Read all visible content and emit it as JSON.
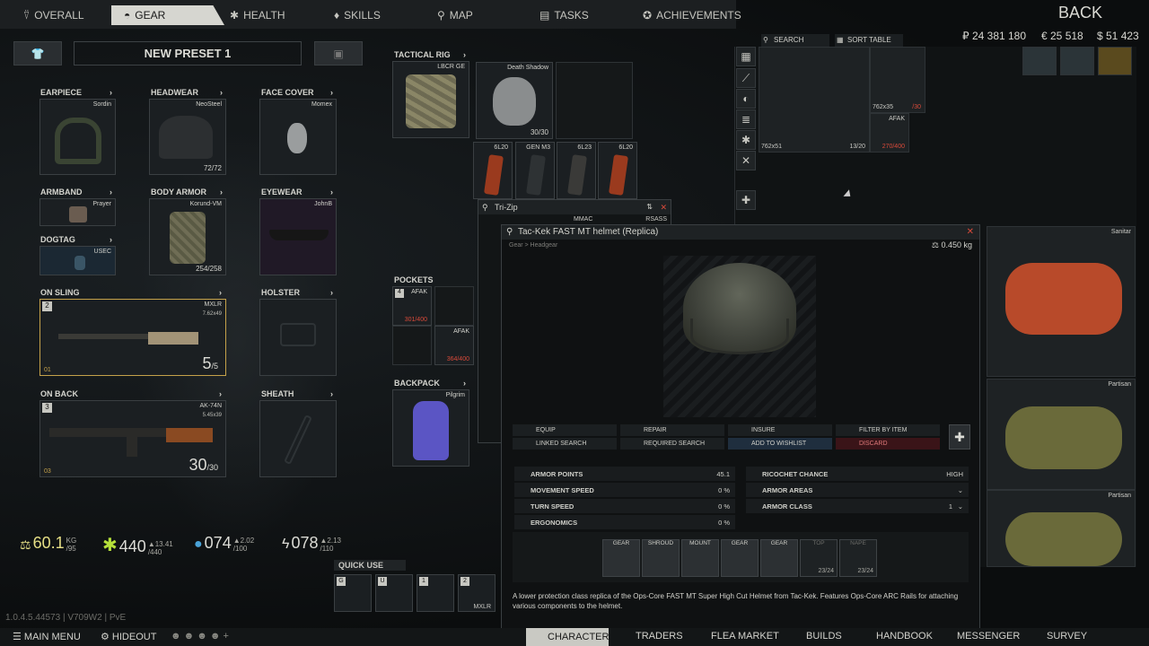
{
  "top_tabs": [
    {
      "label": "OVERALL",
      "icon": "person-icon"
    },
    {
      "label": "GEAR",
      "icon": "helmet-icon",
      "active": true
    },
    {
      "label": "HEALTH",
      "icon": "plus-icon"
    },
    {
      "label": "SKILLS",
      "icon": "bulb-icon"
    },
    {
      "label": "MAP",
      "icon": "pin-icon"
    },
    {
      "label": "TASKS",
      "icon": "clipboard-icon"
    },
    {
      "label": "ACHIEVEMENTS",
      "icon": "star-icon"
    }
  ],
  "back_label": "BACK",
  "currency": {
    "roubles": "₽ 24 381 180",
    "euros": "€ 25 518",
    "dollars": "$ 51 423"
  },
  "stash_toolbar": {
    "search": "SEARCH",
    "sort": "SORT TABLE"
  },
  "preset_name": "NEW PRESET 1",
  "slots": {
    "earpiece": {
      "title": "EARPIECE",
      "item": "Sordin"
    },
    "headwear": {
      "title": "HEADWEAR",
      "item": "NeoSteel",
      "durability": "72/72"
    },
    "face_cover": {
      "title": "FACE COVER",
      "item": "Momex"
    },
    "armband": {
      "title": "ARMBAND",
      "item": "Prayer"
    },
    "body_armor": {
      "title": "BODY ARMOR",
      "item": "Korund-VM",
      "durability": "254/258"
    },
    "eyewear": {
      "title": "EYEWEAR",
      "item": "JohnB"
    },
    "dogtag": {
      "title": "DOGTAG",
      "item": "USEC"
    },
    "on_sling": {
      "title": "ON SLING",
      "item": "MXLR",
      "caliber": "7.62x49",
      "ammo": "5",
      "ammo_max": "/5",
      "slot_num": "2",
      "mag_count": "01"
    },
    "holster": {
      "title": "HOLSTER"
    },
    "on_back": {
      "title": "ON BACK",
      "item": "AK-74N",
      "caliber": "5.45x39",
      "ammo": "30",
      "ammo_max": "/30",
      "slot_num": "3",
      "mag_count": "03"
    },
    "sheath": {
      "title": "SHEATH"
    },
    "tactical_rig": {
      "title": "TACTICAL RIG",
      "item": "LBCR GE"
    },
    "pockets": {
      "title": "POCKETS"
    },
    "backpack": {
      "title": "BACKPACK",
      "item": "Pilgrim"
    }
  },
  "rig_items": {
    "death_shadow": {
      "name": "Death Shadow",
      "count": "30/30"
    },
    "mags": [
      "6L20",
      "GEN M3",
      "6L23",
      "6L20"
    ]
  },
  "pocket_items": [
    {
      "name": "AFAK",
      "durability": "301/400",
      "num": "4"
    },
    {
      "name": "AFAK",
      "durability": "364/400"
    }
  ],
  "stats": {
    "weight": {
      "value": "60.1",
      "unit": "KG",
      "max": "/95"
    },
    "energy": {
      "value": "440",
      "max": "/440",
      "delta": "▲13.41"
    },
    "hydration": {
      "value": "074",
      "max": "/100",
      "delta": "▲2.02"
    },
    "stamina": {
      "value": "078",
      "max": "/110",
      "delta": "▲2.13"
    }
  },
  "quick_use": {
    "title": "QUICK USE",
    "keys": [
      "G",
      "U",
      "1",
      "2"
    ],
    "item": "MXLR"
  },
  "version": "1.0.4.5.44573 | V709W2 | PvE",
  "stash_items": [
    {
      "name": "762x51",
      "count": "13/20"
    },
    {
      "name": "762x35",
      "count": "/30"
    },
    {
      "name": "AFAK",
      "durability": "270/400"
    },
    {
      "name": "Sanitar"
    },
    {
      "name": "Partisan"
    },
    {
      "name": "Partisan"
    }
  ],
  "trizip_window": {
    "title": "Tri-Zip",
    "items": [
      "MMAC",
      "RSASS"
    ]
  },
  "inspect": {
    "title": "Tac-Kek FAST MT helmet (Replica)",
    "breadcrumb": "Gear > Headgear",
    "weight": "0.450 kg",
    "actions": [
      "EQUIP",
      "REPAIR",
      "INSURE",
      "FILTER BY ITEM",
      "LINKED SEARCH",
      "REQUIRED SEARCH",
      "ADD TO WISHLIST",
      "DISCARD"
    ],
    "properties_left": [
      {
        "label": "ARMOR POINTS",
        "value": "45.1"
      },
      {
        "label": "MOVEMENT SPEED",
        "value": "0 %"
      },
      {
        "label": "TURN SPEED",
        "value": "0 %"
      },
      {
        "label": "ERGONOMICS",
        "value": "0 %"
      }
    ],
    "properties_right": [
      {
        "label": "RICOCHET CHANCE",
        "value": "High"
      },
      {
        "label": "ARMOR AREAS",
        "value": ""
      },
      {
        "label": "ARMOR CLASS",
        "value": "1"
      }
    ],
    "mods": [
      {
        "label": "GEAR"
      },
      {
        "label": "SHROUD"
      },
      {
        "label": "MOUNT"
      },
      {
        "label": "GEAR"
      },
      {
        "label": "GEAR"
      },
      {
        "label": "TOP",
        "count": "23/24"
      },
      {
        "label": "NAPE",
        "count": "23/24"
      }
    ],
    "description": "A lower protection class replica of the Ops-Core FAST MT Super High Cut Helmet from Tac-Kek. Features Ops-Core ARC Rails for attaching various components to the helmet."
  },
  "bottom_nav": [
    "MAIN MENU",
    "HIDEOUT",
    "CHARACTER",
    "TRADERS",
    "FLEA MARKET",
    "BUILDS",
    "HANDBOOK",
    "MESSENGER",
    "SURVEY"
  ],
  "colors": {
    "accent": "#e6df86",
    "energy": "#b5e03a",
    "water": "#4aa3d8",
    "warning": "#d94a3a"
  }
}
